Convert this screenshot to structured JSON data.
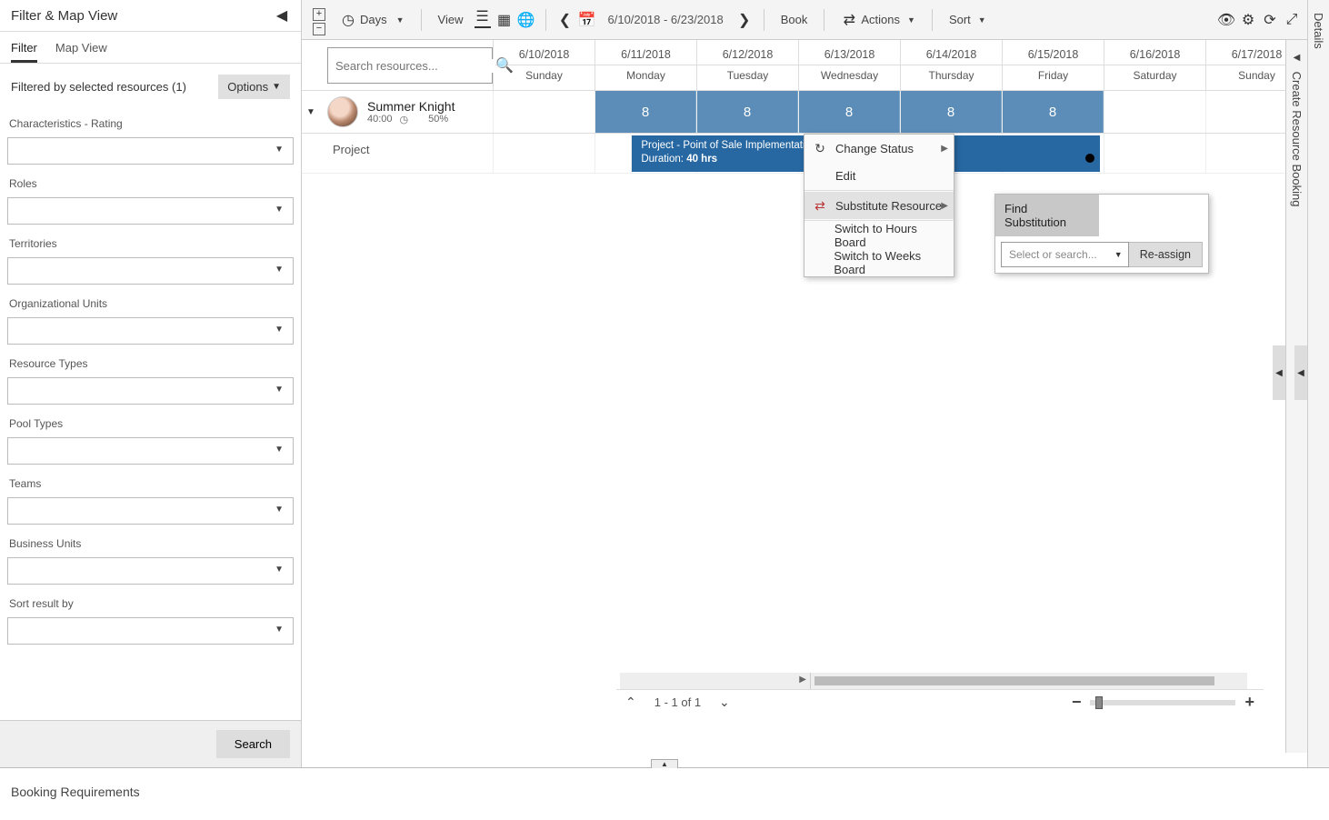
{
  "leftPanel": {
    "title": "Filter & Map View",
    "tabs": {
      "filter": "Filter",
      "mapView": "Map View"
    },
    "filteredRow": "Filtered by selected resources (1)",
    "optionsLabel": "Options",
    "filters": {
      "characteristics": "Characteristics - Rating",
      "roles": "Roles",
      "territories": "Territories",
      "orgUnits": "Organizational Units",
      "resourceTypes": "Resource Types",
      "poolTypes": "Pool Types",
      "teams": "Teams",
      "businessUnits": "Business Units",
      "sortResult": "Sort result by"
    },
    "searchBtn": "Search"
  },
  "toolbar": {
    "days": "Days",
    "viewLabel": "View",
    "dateRange": "6/10/2018 - 6/23/2018",
    "book": "Book",
    "actions": "Actions",
    "sort": "Sort"
  },
  "searchResources": {
    "placeholder": "Search resources..."
  },
  "columns": [
    {
      "date": "6/10/2018",
      "day": "Sunday"
    },
    {
      "date": "6/11/2018",
      "day": "Monday"
    },
    {
      "date": "6/12/2018",
      "day": "Tuesday"
    },
    {
      "date": "6/13/2018",
      "day": "Wednesday"
    },
    {
      "date": "6/14/2018",
      "day": "Thursday"
    },
    {
      "date": "6/15/2018",
      "day": "Friday"
    },
    {
      "date": "6/16/2018",
      "day": "Saturday"
    },
    {
      "date": "6/17/2018",
      "day": "Sunday"
    }
  ],
  "resource": {
    "name": "Summer Knight",
    "hours": "40:00",
    "utilization": "50%",
    "capacity": [
      "",
      "8",
      "8",
      "8",
      "8",
      "8",
      "",
      ""
    ]
  },
  "project": {
    "rowLabel": "Project",
    "title": "Project - Point of Sale Implementation",
    "durationLabel": "Duration:",
    "durationValue": "40 hrs"
  },
  "contextMenu": {
    "changeStatus": "Change Status",
    "edit": "Edit",
    "substitute": "Substitute Resource",
    "switchHours": "Switch to Hours Board",
    "switchWeeks": "Switch to Weeks Board"
  },
  "subPanel": {
    "header": "Find Substitution",
    "placeholder": "Select or search...",
    "reassign": "Re-assign"
  },
  "pager": {
    "text": "1 - 1 of 1"
  },
  "rightRail": {
    "details": "Details",
    "createBooking": "Create Resource Booking"
  },
  "footer": {
    "title": "Booking Requirements"
  }
}
